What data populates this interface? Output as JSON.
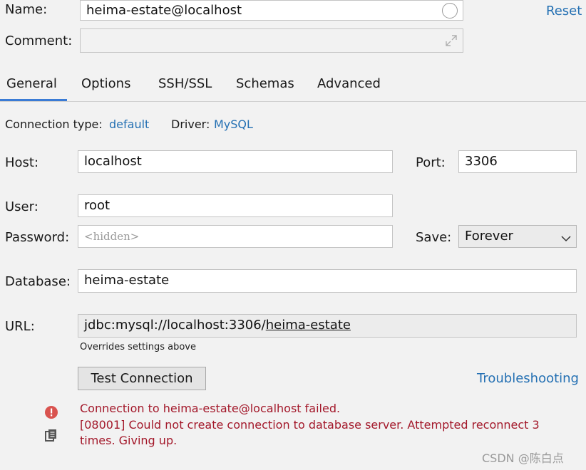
{
  "header": {
    "name_label": "Name:",
    "name_value": "heima-estate@localhost",
    "comment_label": "Comment:",
    "comment_value": "",
    "reset_label": "Reset"
  },
  "tabs": [
    {
      "label": "General",
      "active": true
    },
    {
      "label": "Options",
      "active": false
    },
    {
      "label": "SSH/SSL",
      "active": false
    },
    {
      "label": "Schemas",
      "active": false
    },
    {
      "label": "Advanced",
      "active": false
    }
  ],
  "connection": {
    "type_label": "Connection type:",
    "type_value": "default",
    "driver_label": "Driver:",
    "driver_value": "MySQL"
  },
  "form": {
    "host_label": "Host:",
    "host_value": "localhost",
    "port_label": "Port:",
    "port_value": "3306",
    "user_label": "User:",
    "user_value": "root",
    "password_label": "Password:",
    "password_placeholder": "<hidden>",
    "save_label": "Save:",
    "save_value": "Forever",
    "database_label": "Database:",
    "database_value": "heima-estate",
    "url_label": "URL:",
    "url_prefix": "jdbc:mysql://localhost:3306/",
    "url_db": "heima-estate",
    "url_note": "Overrides settings above"
  },
  "actions": {
    "test_connection_label": "Test Connection",
    "troubleshooting_label": "Troubleshooting"
  },
  "error": {
    "line1": "Connection to heima-estate@localhost failed.",
    "line2": "[08001] Could not create connection to database server. Attempted reconnect 3",
    "line3": "times. Giving up."
  },
  "watermark": "CSDN @陈白点",
  "colors": {
    "link": "#2470b3",
    "error_text": "#a3182a",
    "error_icon": "#d9534f",
    "active_tab_underline": "#3a7bd5"
  }
}
